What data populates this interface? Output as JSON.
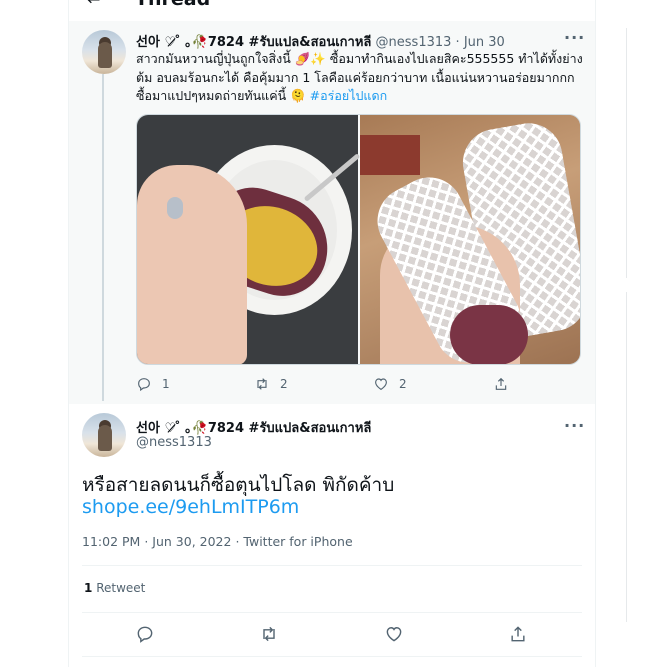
{
  "header": {
    "back_icon": "arrow-left-icon",
    "title": "Thread"
  },
  "parent_tweet": {
    "display_name": "선아 ♡̷̷ ̊ ｡🥀7824 #รับแปล&สอนเกาหลี",
    "handle": "@ness1313",
    "separator": "·",
    "date": "Jun 30",
    "more": "···",
    "text": "สาวกมันหวานญี่ปุ่นถูกใจสิ่งนี้ 🍠✨ ซื้อมาทำกินเองไปเลยสิคะ555555 ทำได้ทั้งย่าง ต้ม อบลมร้อนกะได้ คือคุ้มมาก 1 โลคือแค่ร้อยกว่าบาท เนื้อแน่นหวานอร่อยมากกก ซื้อมาแปปๆหมดถ่ายทันแค่นี้ 🫠",
    "hashtag": "#อร่อยไปแดก",
    "replies": "1",
    "retweets": "2",
    "likes": "2"
  },
  "focus_tweet": {
    "display_name": "선아 ♡̷̷ ̊ ｡🥀7824 #รับแปล&สอนเกาหลี",
    "handle": "@ness1313",
    "more": "···",
    "text": "หรือสายลดนนก็ซื้อตุนไปโลด พิกัดค้าบ",
    "link": "shope.ee/9ehLmITP6m",
    "time": "11:02 PM",
    "date": "Jun 30, 2022",
    "separator": "·",
    "source": "Twitter for iPhone",
    "retweet_count": "1",
    "retweet_label": "Retweet"
  },
  "icons": [
    "arrow-left-icon",
    "more-icon",
    "reply-icon",
    "retweet-icon",
    "like-icon",
    "share-icon"
  ]
}
